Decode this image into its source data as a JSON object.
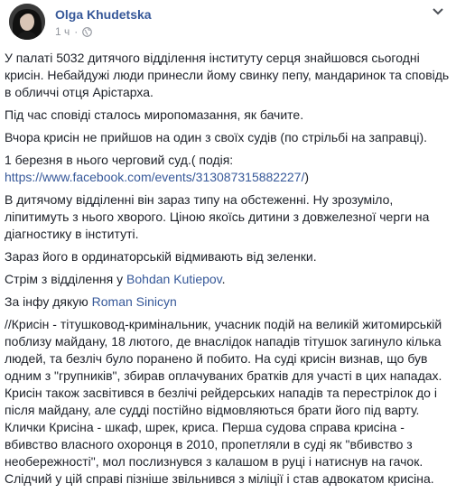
{
  "post": {
    "author": "Olga Khudetska",
    "time": "1 ч",
    "separator": "·"
  },
  "content": {
    "p1": "У палаті 5032 дитячого відділення інституту серця знайшовся сьогодні крисін. Небайдужі люди принесли йому свинку пепу, мандаринок та сповідь в обличчі отця Арістарха.",
    "p2": "Під час сповіді сталось миропомазання, як бачите.",
    "p3": "Вчора крисін не прийшов на один з своїх судів (по стрільбі на заправці).",
    "p4_text": "1 березня в нього черговий суд.( подія:",
    "p4_link": "https://www.facebook.com/events/313087315882227/",
    "p4_end": ")",
    "p5": "В дитячому відділенні він зараз типу на обстеженні. Ну зрозуміло, ліпитимуть з нього хворого. Ціною якоїсь дитини з довжелезної черги на діагностику в інституті.",
    "p6": "Зараз його в ординаторській відмивають від зеленки.",
    "p7_text": "Стрім з відділення у",
    "p7_link": "Bohdan Kutiepov",
    "p7_end": ".",
    "p8_text": "За інфу дякую",
    "p8_link": "Roman Sinicyn",
    "p9": "//Крисін - тітушковод-кримінальник, учасник подій на великій житомирській поблизу майдану, 18 лютого, де внаслідок нападів тітушок загинуло кілька людей, та безліч було поранено й побито. На суді крисін визнав, що був одним з \"групників\", збирав оплачуваних братків для участі в цих нападах. Крисін також засвітився в безлічі рейдерських нападів та перестрілок до і після майдану, але судді постійно відмовляються брати його під варту. Клички Крисіна - шкаф, шрек, криса. Перша судова справа крисіна - вбивство власного охоронця в 2010, пропетляли в суді як \"вбивство з необережності\", мол послизнувся з калашом в руці і натиснув на гачок. Слідчий у цій справі пізніше звільнився з міліції і став адвокатом крисіна."
  },
  "icons": {
    "avatar": "profile-photo",
    "privacy": "globe-icon",
    "options": "chevron-down-icon"
  }
}
